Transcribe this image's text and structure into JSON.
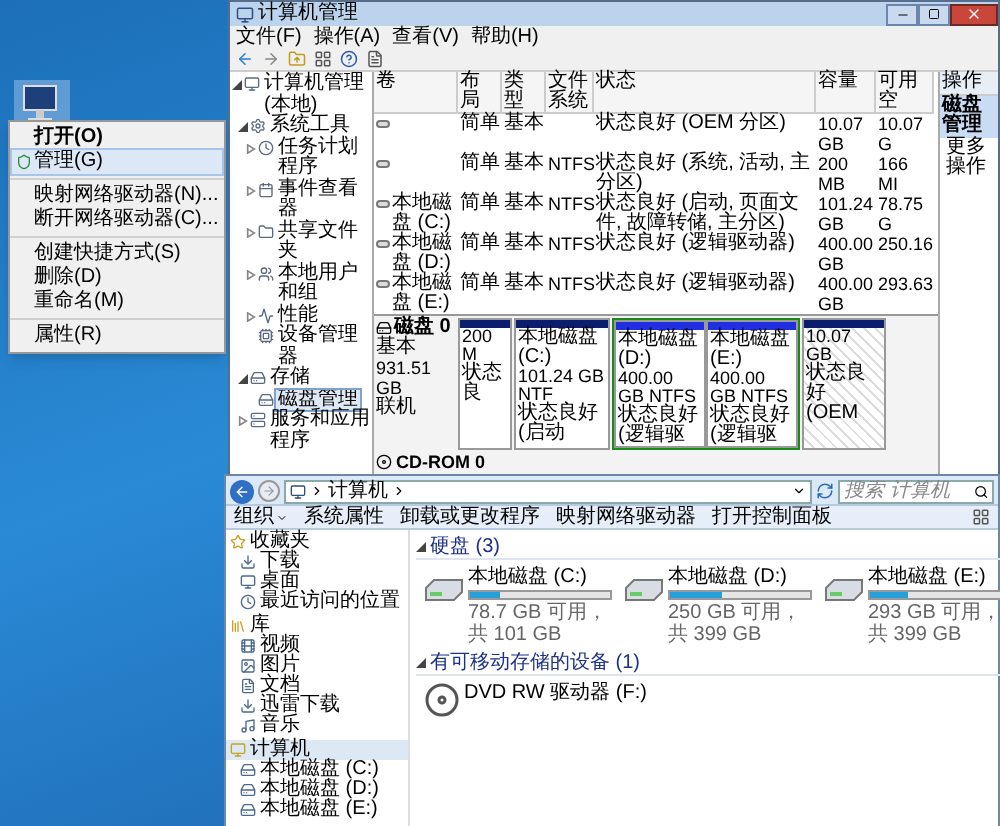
{
  "context_menu": {
    "groups": [
      [
        {
          "label": "打开(O)",
          "kind": "default",
          "selected": false
        },
        {
          "label": "管理(G)",
          "kind": "shield",
          "selected": true
        }
      ],
      [
        {
          "label": "映射网络驱动器(N)...",
          "kind": "plain",
          "selected": false
        },
        {
          "label": "断开网络驱动器(C)...",
          "kind": "plain",
          "selected": false
        }
      ],
      [
        {
          "label": "创建快捷方式(S)",
          "kind": "plain",
          "selected": false
        },
        {
          "label": "删除(D)",
          "kind": "plain",
          "selected": false
        },
        {
          "label": "重命名(M)",
          "kind": "plain",
          "selected": false
        }
      ],
      [
        {
          "label": "属性(R)",
          "kind": "plain",
          "selected": false
        }
      ]
    ]
  },
  "management": {
    "title": "计算机管理",
    "menu": [
      "文件(F)",
      "操作(A)",
      "查看(V)",
      "帮助(H)"
    ],
    "tree": [
      {
        "label": "计算机管理(本地)",
        "selected": false,
        "expanded": true,
        "children": [
          {
            "label": "系统工具",
            "selected": false,
            "expanded": true,
            "children": [
              {
                "label": "任务计划程序",
                "selected": false,
                "expanded": false
              },
              {
                "label": "事件查看器",
                "selected": false,
                "expanded": false
              },
              {
                "label": "共享文件夹",
                "selected": false,
                "expanded": false
              },
              {
                "label": "本地用户和组",
                "selected": false,
                "expanded": false
              },
              {
                "label": "性能",
                "selected": false,
                "expanded": false
              },
              {
                "label": "设备管理器",
                "selected": false
              }
            ]
          },
          {
            "label": "存储",
            "selected": false,
            "expanded": true,
            "children": [
              {
                "label": "磁盘管理",
                "selected": true
              }
            ]
          },
          {
            "label": "服务和应用程序",
            "selected": false,
            "expanded": false
          }
        ]
      }
    ],
    "table": {
      "columns": [
        "卷",
        "布局",
        "类型",
        "文件系统",
        "状态",
        "容量",
        "可用空"
      ],
      "rows": [
        [
          "",
          "简单",
          "基本",
          "",
          "状态良好 (OEM 分区)",
          "10.07 GB",
          "10.07 G"
        ],
        [
          "",
          "简单",
          "基本",
          "NTFS",
          "状态良好 (系统, 活动, 主分区)",
          "200 MB",
          "166 MI"
        ],
        [
          "本地磁盘 (C:)",
          "简单",
          "基本",
          "NTFS",
          "状态良好 (启动, 页面文件, 故障转储, 主分区)",
          "101.24 GB",
          "78.75 G"
        ],
        [
          "本地磁盘 (D:)",
          "简单",
          "基本",
          "NTFS",
          "状态良好 (逻辑驱动器)",
          "400.00 GB",
          "250.16"
        ],
        [
          "本地磁盘 (E:)",
          "简单",
          "基本",
          "NTFS",
          "状态良好 (逻辑驱动器)",
          "400.00 GB",
          "293.63"
        ]
      ]
    },
    "disk": {
      "name": "磁盘 0",
      "type": "基本",
      "size": "931.51 GB",
      "status": "联机",
      "partitions": [
        {
          "kind": "primary",
          "lines": [
            "200 M",
            "状态良"
          ]
        },
        {
          "kind": "primary",
          "lines": [
            "本地磁盘 (C:)",
            "101.24 GB NTF",
            "状态良好 (启动"
          ]
        },
        {
          "kind": "logical",
          "lines": [
            "本地磁盘 (D:)",
            "400.00 GB NTFS",
            "状态良好 (逻辑驱"
          ]
        },
        {
          "kind": "logical",
          "lines": [
            "本地磁盘 (E:)",
            "400.00 GB NTFS",
            "状态良好 (逻辑驱"
          ]
        },
        {
          "kind": "oem",
          "lines": [
            "10.07 GB",
            "状态良好 (OEM"
          ]
        }
      ]
    },
    "cdrom": "CD-ROM 0",
    "actions": {
      "header": "操作",
      "items": [
        {
          "label": "磁盘管理",
          "selected": true
        },
        {
          "label": "更多操作",
          "selected": false
        }
      ]
    }
  },
  "explorer": {
    "breadcrumb": [
      "计算机"
    ],
    "search": {
      "placeholder": "搜索 计算机"
    },
    "commands": [
      "组织",
      "系统属性",
      "卸载或更改程序",
      "映射网络驱动器",
      "打开控制面板"
    ],
    "nav": [
      {
        "label": "收藏夹",
        "selected": false,
        "items": [
          {
            "label": "下载",
            "selected": false
          },
          {
            "label": "桌面",
            "selected": false
          },
          {
            "label": "最近访问的位置",
            "selected": false
          }
        ]
      },
      {
        "label": "库",
        "selected": false,
        "items": [
          {
            "label": "视频",
            "selected": false
          },
          {
            "label": "图片",
            "selected": false
          },
          {
            "label": "文档",
            "selected": false
          },
          {
            "label": "迅雷下载",
            "selected": false
          },
          {
            "label": "音乐",
            "selected": false
          }
        ]
      },
      {
        "label": "计算机",
        "selected": true,
        "items": [
          {
            "label": "本地磁盘 (C:)",
            "selected": false
          },
          {
            "label": "本地磁盘 (D:)",
            "selected": false
          },
          {
            "label": "本地磁盘 (E:)",
            "selected": false
          }
        ]
      }
    ],
    "groups": [
      {
        "title": "硬盘 (3)",
        "kind": "drives",
        "items": [
          {
            "name": "本地磁盘 (C:)",
            "level": 0.22,
            "free": "78.7 GB 可用，共 101 GB"
          },
          {
            "name": "本地磁盘 (D:)",
            "level": 0.37,
            "free": "250 GB 可用，共 399 GB"
          },
          {
            "name": "本地磁盘 (E:)",
            "level": 0.27,
            "free": "293 GB 可用，共 399 GB"
          }
        ]
      },
      {
        "title": "有可移动存储的设备 (1)",
        "kind": "removable",
        "items": [
          {
            "name": "DVD RW 驱动器 (F:)"
          }
        ]
      }
    ]
  }
}
